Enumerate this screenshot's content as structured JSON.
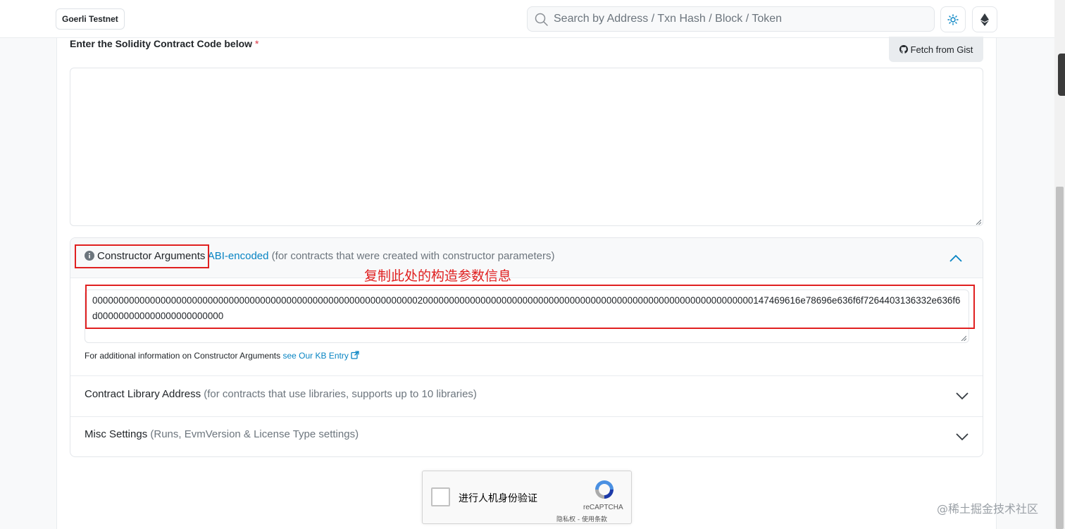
{
  "header": {
    "network_label": "Goerli Testnet",
    "search_placeholder": "Search by Address / Txn Hash / Block / Token",
    "theme_icon": "sun-icon",
    "chain_icon": "ethereum-icon"
  },
  "contract_code": {
    "label": "Enter the Solidity Contract Code below",
    "required_mark": "*",
    "fetch_button_label": "Fetch from Gist",
    "fetch_button_icon": "github-icon",
    "value": ""
  },
  "constructor_args": {
    "title": "Constructor Arguments",
    "link_text": "ABI-encoded",
    "hint": "(for contracts that were created with constructor parameters)",
    "value": "000000000000000000000000000000000000000000000000000000000000002000000000000000000000000000000000000000000000000000000000000000147469616e78696e636f6f7264403136332e636f6d000000000000000000000000",
    "note_prefix": "For additional information on Constructor Arguments",
    "note_link": "see Our KB Entry",
    "expanded": true
  },
  "library_address": {
    "title": "Contract Library Address",
    "hint": "(for contracts that use libraries, supports up to 10 libraries)"
  },
  "misc_settings": {
    "title": "Misc Settings",
    "hint": "(Runs, EvmVersion & License Type settings)"
  },
  "annotation": {
    "text": "复制此处的构造参数信息",
    "color": "#e02020"
  },
  "recaptcha": {
    "label": "进行人机身份验证",
    "brand": "reCAPTCHA",
    "terms": "隐私权 - 使用条款"
  },
  "watermark": "@稀土掘金技术社区",
  "colors": {
    "link": "#0784c3",
    "required": "#dc3545"
  }
}
